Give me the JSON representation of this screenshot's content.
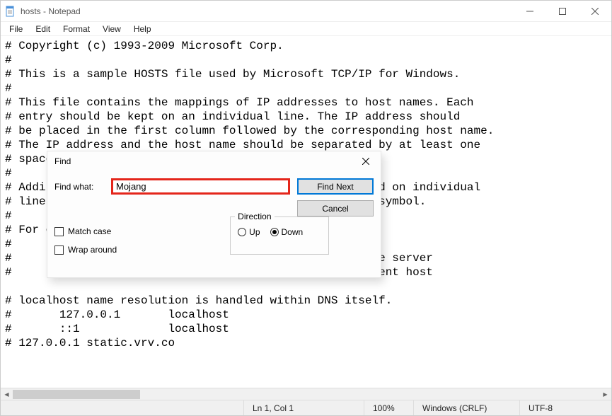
{
  "window": {
    "title": "hosts - Notepad"
  },
  "menu": {
    "file": "File",
    "edit": "Edit",
    "format": "Format",
    "view": "View",
    "help": "Help"
  },
  "editor": {
    "content": "# Copyright (c) 1993-2009 Microsoft Corp.\n#\n# This is a sample HOSTS file used by Microsoft TCP/IP for Windows.\n#\n# This file contains the mappings of IP addresses to host names. Each\n# entry should be kept on an individual line. The IP address should\n# be placed in the first column followed by the corresponding host name.\n# The IP address and the host name should be separated by at least one\n# space.\n#\n# Additionally, comments (such as these) may be inserted on individual\n# lines or following the machine name denoted by a '#' symbol.\n#\n# For example:\n#\n#      102.54.94.97     rhino.acme.com          # source server\n#       38.25.63.10     x.acme.com              # x client host\n\n# localhost name resolution is handled within DNS itself.\n#       127.0.0.1       localhost\n#       ::1             localhost\n# 127.0.0.1 static.vrv.co"
  },
  "find": {
    "title": "Find",
    "label": "Find what:",
    "value": "Mojang",
    "find_next": "Find Next",
    "cancel": "Cancel",
    "direction_label": "Direction",
    "up": "Up",
    "down": "Down",
    "match_case": "Match case",
    "wrap_around": "Wrap around"
  },
  "status": {
    "position": "Ln 1, Col 1",
    "zoom": "100%",
    "line_ending": "Windows (CRLF)",
    "encoding": "UTF-8"
  }
}
